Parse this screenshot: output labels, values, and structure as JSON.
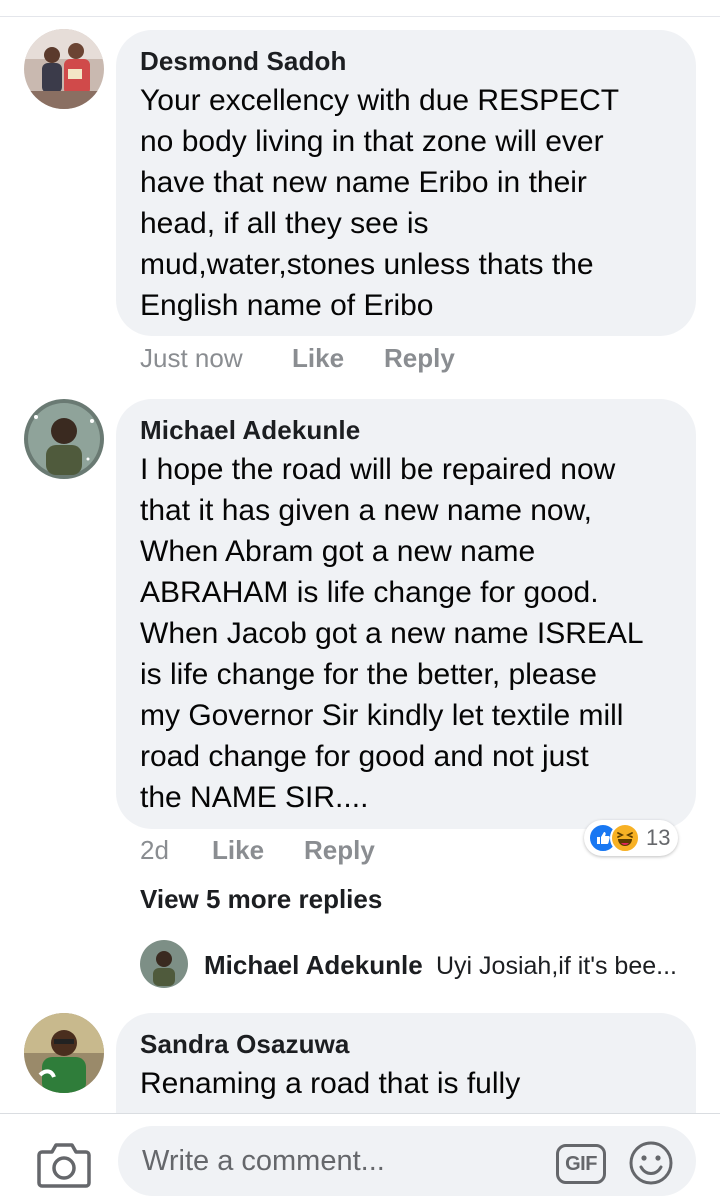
{
  "comments": [
    {
      "author": "Desmond Sadoh",
      "text": "Your excellency with due RESPECT\nno body living in that zone will ever\nhave that new name Eribo in their\nhead, if all they see is\nmud,water,stones unless thats the\nEnglish name of Eribo",
      "time": "Just now",
      "like_label": "Like",
      "reply_label": "Reply"
    },
    {
      "author": "Michael Adekunle",
      "text": "I hope the road will be repaired now\nthat it has given a new name now,\nWhen Abram got a new name\nABRAHAM is life change for good.\nWhen Jacob got a new name ISREAL\nis life change for the better, please\nmy Governor Sir kindly let textile mill\nroad change for good and not just\nthe NAME SIR....",
      "time": "2d",
      "like_label": "Like",
      "reply_label": "Reply",
      "reaction_count": "13",
      "reaction_icons": [
        "like-icon",
        "haha-icon"
      ]
    },
    {
      "author": "Sandra Osazuwa",
      "text": "Renaming a road that is fully"
    }
  ],
  "view_more_replies": "View 5 more replies",
  "reply_preview": {
    "author": "Michael Adekunle",
    "snippet": "Uyi Josiah,if it's bee..."
  },
  "composer": {
    "placeholder": "Write a comment...",
    "gif_label": "GIF",
    "camera_icon": "camera-icon",
    "emoji_icon": "emoji-icon"
  },
  "colors": {
    "bubble": "#f0f2f5",
    "meta": "#8a8d91",
    "like_blue": "#1877f2",
    "haha_yellow": "#f7b125"
  }
}
